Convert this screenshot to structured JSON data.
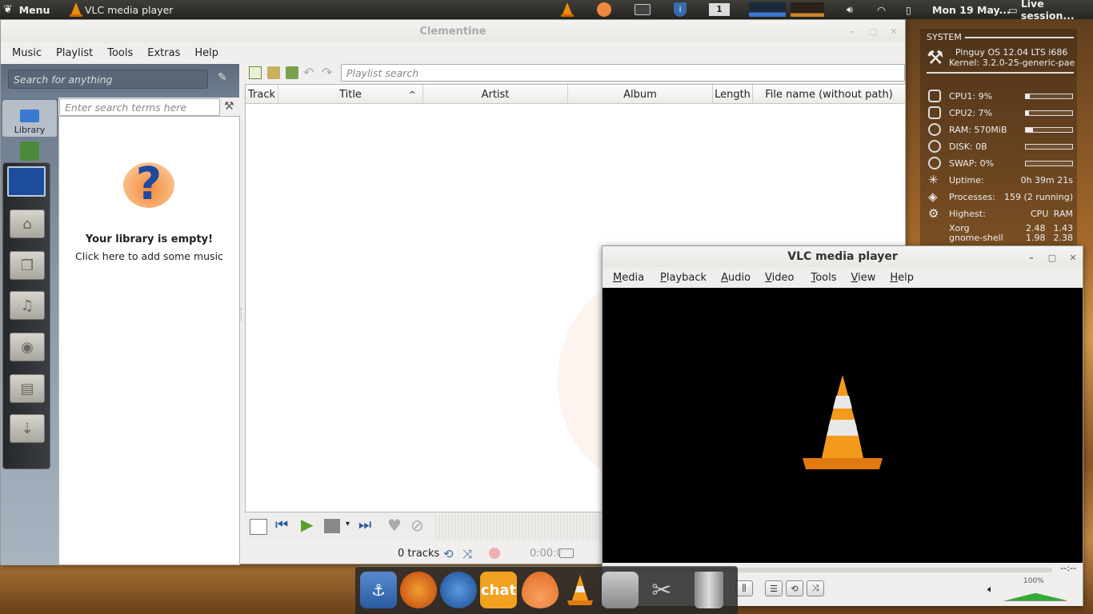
{
  "top_panel": {
    "menu_label": "Menu",
    "active_app": "VLC media player",
    "workspace": "1",
    "clock": "Mon 19 May...",
    "session": "Live session..."
  },
  "clementine": {
    "title": "Clementine",
    "menu": [
      "Music",
      "Playlist",
      "Tools",
      "Extras",
      "Help"
    ],
    "search_placeholder": "Search for anything",
    "library_search_placeholder": "Enter search terms here",
    "playlist_search_placeholder": "Playlist search",
    "sidebar_library_label": "Library",
    "empty_title": "Your library is empty!",
    "empty_subtitle": "Click here to add some music",
    "columns": [
      "Track",
      "Title",
      "Artist",
      "Album",
      "Length",
      "File name (without path)"
    ],
    "track_count": "0 tracks",
    "time": "0:00:00"
  },
  "vlc": {
    "title": "VLC media player",
    "menu": [
      "Media",
      "Playback",
      "Audio",
      "Video",
      "Tools",
      "View",
      "Help"
    ],
    "time_right": "--:--",
    "volume": "100%"
  },
  "conky": {
    "header": "SYSTEM",
    "os": "Pinguy OS 12.04 LTS i686",
    "kernel": "Kernel: 3.2.0-25-generic-pae",
    "rows": [
      {
        "label": "CPU1: 9%",
        "fill": 0.09
      },
      {
        "label": "CPU2: 7%",
        "fill": 0.07
      },
      {
        "label": "RAM: 570MiB",
        "fill": 0.15
      },
      {
        "label": "DISK: 0B",
        "fill": 0.0
      },
      {
        "label": "SWAP: 0%",
        "fill": 0.0
      }
    ],
    "uptime_label": "Uptime:",
    "uptime_value": "0h 39m 21s",
    "processes_label": "Processes:",
    "processes_value": "159 (2 running)",
    "highest_label": "Highest:",
    "cpu_col": "CPU",
    "ram_col": "RAM",
    "procs": [
      {
        "name": "Xorg",
        "cpu": "2.48",
        "ram": "1.43"
      },
      {
        "name": "gnome-shell",
        "cpu": "1.98",
        "ram": "2.38"
      }
    ]
  },
  "dock": {
    "chat_label": "chat"
  }
}
